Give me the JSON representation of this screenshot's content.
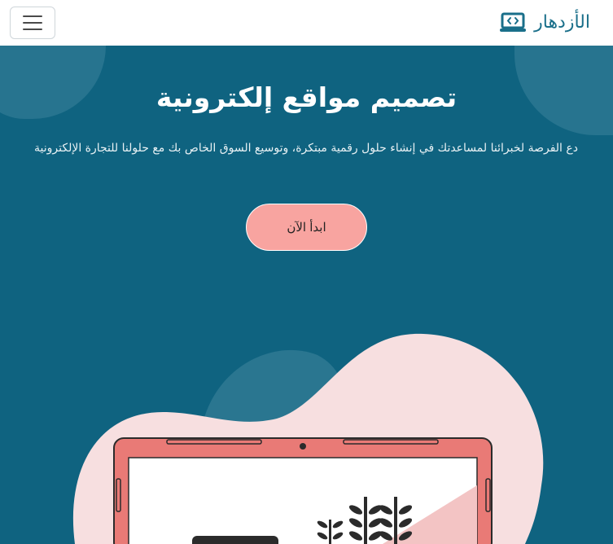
{
  "navbar": {
    "brand_name": "الأزدهار",
    "brand_icon": "laptop-code-icon",
    "menu_icon": "hamburger-menu-icon"
  },
  "hero": {
    "title": "تصميم مواقع إلكترونية",
    "subtitle": "دع الفرصة لخبرائنا لمساعدتك في إنشاء حلول رقمية مبتكرة، وتوسيع السوق الخاص بك مع حلولنا للتجارة الإلكترونية",
    "cta_label": "ابدأ الآن"
  },
  "colors": {
    "brand": "#1a6f8a",
    "hero_bg": "#0f6380",
    "cta_bg": "#f8a4a0",
    "illustration_blob": "#f7dfe0",
    "laptop_frame": "#e97a76"
  }
}
